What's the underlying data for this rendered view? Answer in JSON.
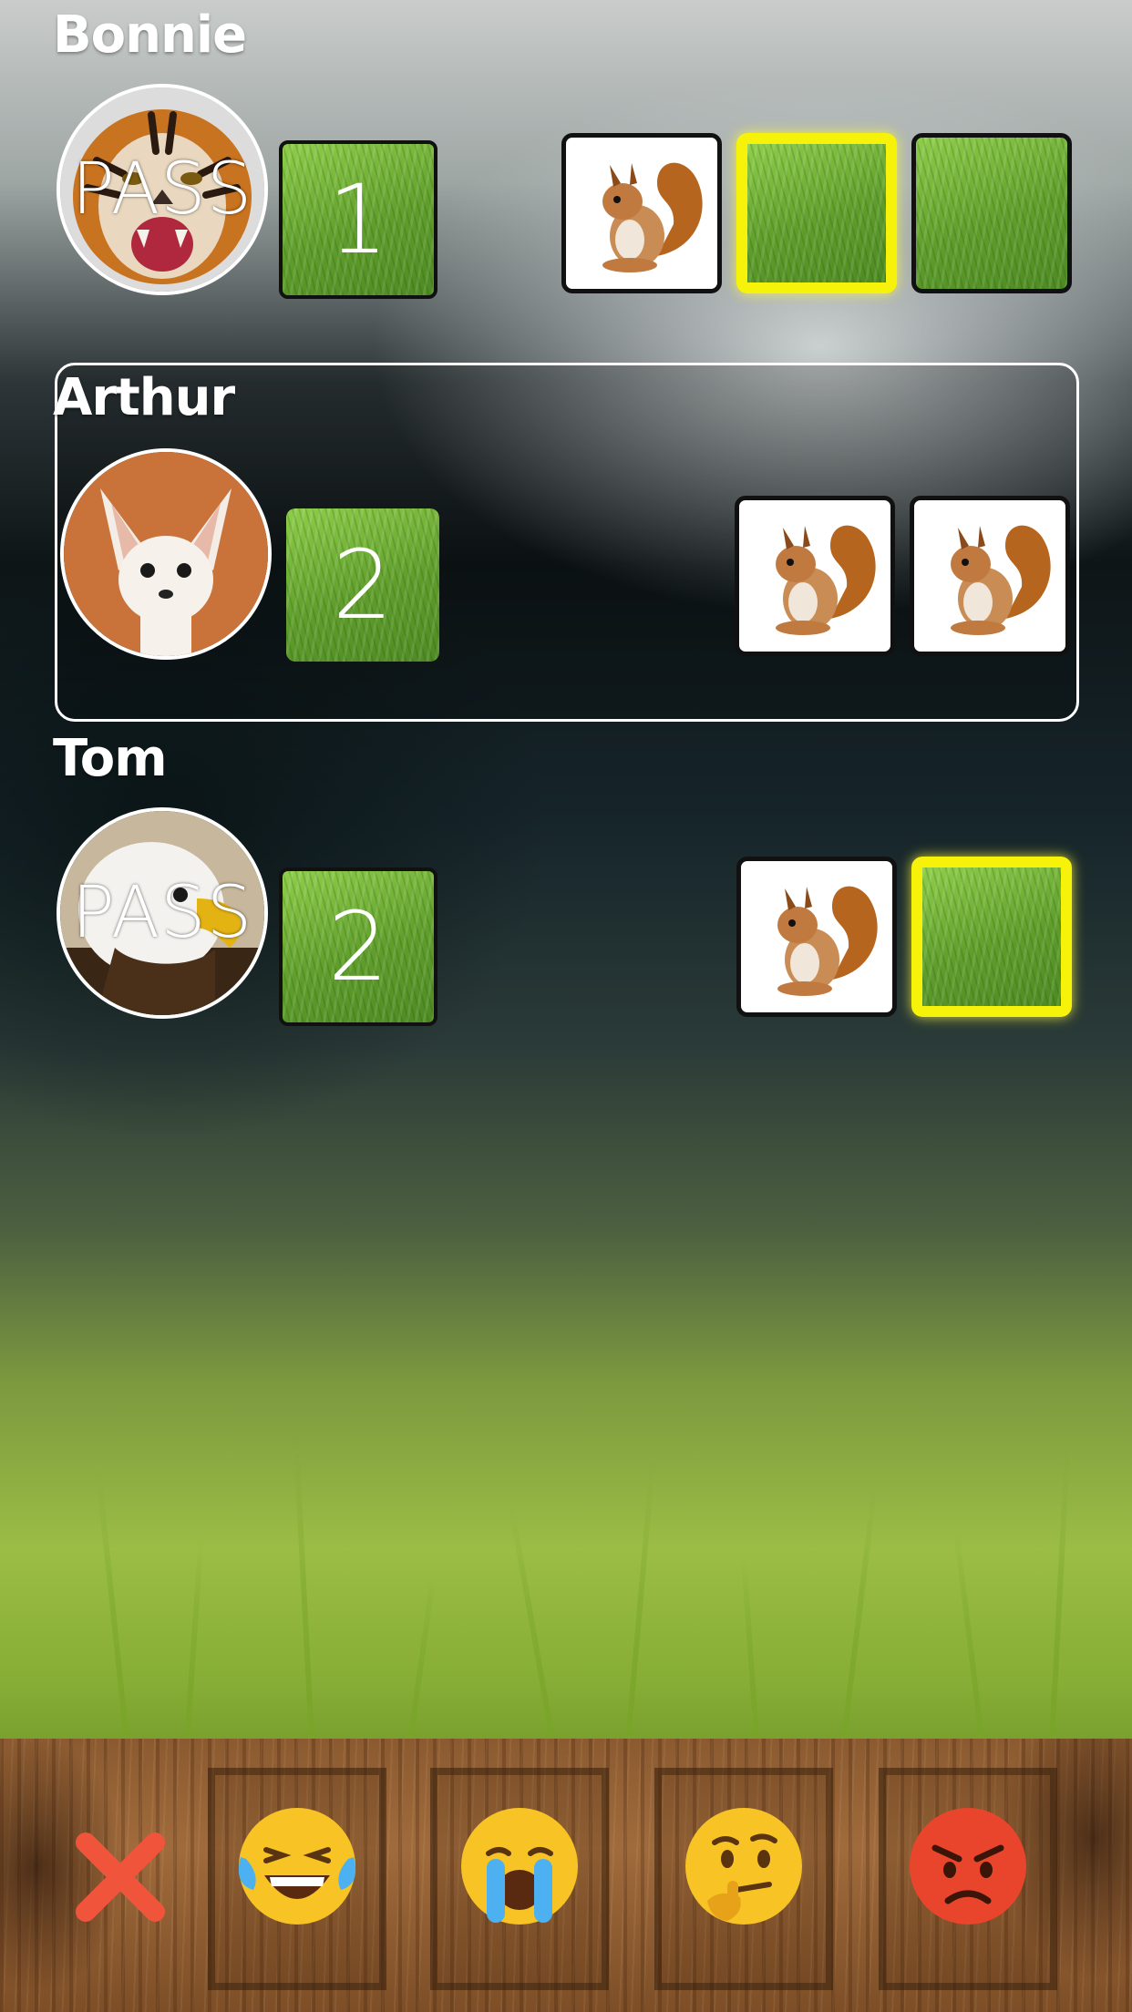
{
  "players": [
    {
      "name": "Bonnie",
      "avatar_icon": "tiger-avatar-icon",
      "avatar_status": "PASS",
      "score": "1",
      "cards": [
        "squirrel",
        "grass-selected",
        "grass"
      ]
    },
    {
      "name": "Arthur",
      "avatar_icon": "fennec-fox-avatar-icon",
      "avatar_status": "",
      "score": "2",
      "active_turn": true,
      "cards": [
        "squirrel",
        "squirrel"
      ]
    },
    {
      "name": "Tom",
      "avatar_icon": "eagle-avatar-icon",
      "avatar_status": "PASS",
      "score": "2",
      "cards": [
        "squirrel",
        "grass-selected"
      ]
    }
  ],
  "reaction_bar": {
    "close_icon": "close-icon",
    "emojis": [
      "laughing-tears-emoji-icon",
      "crying-emoji-icon",
      "thinking-emoji-icon",
      "angry-emoji-icon"
    ]
  },
  "colors": {
    "selected_card_border": "#f7f20a",
    "close_x": "#f0553c"
  }
}
